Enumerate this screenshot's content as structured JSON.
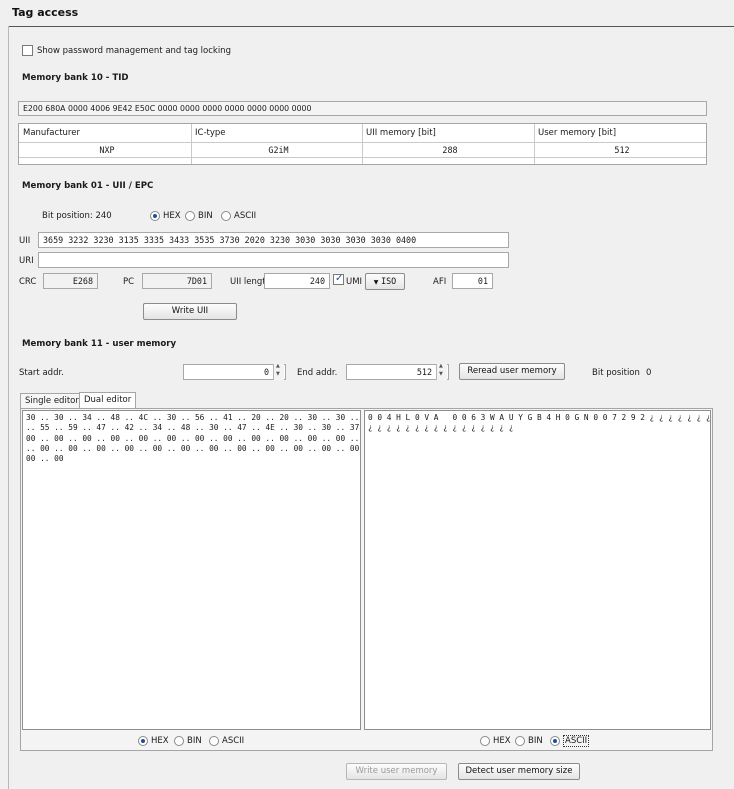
{
  "panel": {
    "title": "Tag access"
  },
  "options": {
    "show_password_label": "Show password management and tag locking",
    "show_password_checked": false
  },
  "tid": {
    "heading": "Memory bank 10 - TID",
    "value": "E200 680A 0000 4006 9E42 E50C 0000 0000 0000 0000 0000 0000 0000",
    "columns": [
      "Manufacturer",
      "IC-type",
      "UII memory [bit]",
      "User memory [bit]"
    ],
    "values": [
      "NXP",
      "G2iM",
      "288",
      "512"
    ]
  },
  "uii_bank": {
    "heading": "Memory bank 01 - UII / EPC",
    "bit_position_label": "Bit position: 240",
    "format_options": [
      "HEX",
      "BIN",
      "ASCII"
    ],
    "format_selected": "HEX",
    "uii_label": "UII",
    "uii_value": "3659 3232 3230 3135 3335 3433 3535 3730 2020 3230 3030 3030 3030 3030 0400",
    "uri_label": "URI",
    "uri_value": "",
    "crc_label": "CRC",
    "crc_value": "E268",
    "pc_label": "PC",
    "pc_value": "7D01",
    "uii_length_label": "UII length",
    "uii_length_value": "240",
    "umi_label": "UMI",
    "umi_checked": true,
    "iso_label": "ISO",
    "afi_label": "AFI",
    "afi_value": "01",
    "write_uii_label": "Write UII"
  },
  "user_bank": {
    "heading": "Memory bank 11 - user memory",
    "start_addr_label": "Start addr.",
    "start_addr_value": "0",
    "end_addr_label": "End addr.",
    "end_addr_value": "512",
    "reread_label": "Reread user memory",
    "bit_position_label": "Bit position",
    "bit_position_value": "0",
    "tabs": [
      "Single editor",
      "Dual editor"
    ],
    "active_tab": "Dual editor",
    "left_editor_text": "30 .. 30 .. 34 .. 48 .. 4C .. 30 .. 56 .. 41 .. 20 .. 20 .. 30 .. 30 .. 36 .. 33 .. 57 .. 41\n.. 55 .. 59 .. 47 .. 42 .. 34 .. 48 .. 30 .. 47 .. 4E .. 30 .. 30 .. 37 .. 32 .. 39 .. 32 ..\n00 .. 00 .. 00 .. 00 .. 00 .. 00 .. 00 .. 00 .. 00 .. 00 .. 00 .. 00 .. 00 .. 00 .. 00 .. 00\n.. 00 .. 00 .. 00 .. 00 .. 00 .. 00 .. 00 .. 00 .. 00 .. 00 .. 00 .. 00 .. 00 .. 00 .. 00 ..\n00 .. 00",
    "right_editor_text": "0 0 4 H L 0 V A   0 0 6 3 W A U Y G B 4 H 0 G N 0 0 7 2 9 2 ¿ ¿ ¿ ¿ ¿ ¿ ¿ ¿ ¿ ¿ ¿ ¿ ¿ ¿ ¿ ¿\n¿ ¿ ¿ ¿ ¿ ¿ ¿ ¿ ¿ ¿ ¿ ¿ ¿ ¿ ¿ ¿",
    "left_format_options": [
      "HEX",
      "BIN",
      "ASCII"
    ],
    "left_format_selected": "HEX",
    "right_format_options": [
      "HEX",
      "BIN",
      "ASCII"
    ],
    "right_format_selected": "ASCII",
    "write_user_label": "Write user memory",
    "detect_label": "Detect user memory size"
  },
  "icons": {
    "dropdown": "triangle-down-icon",
    "spinner": "spin-updown-icon"
  }
}
